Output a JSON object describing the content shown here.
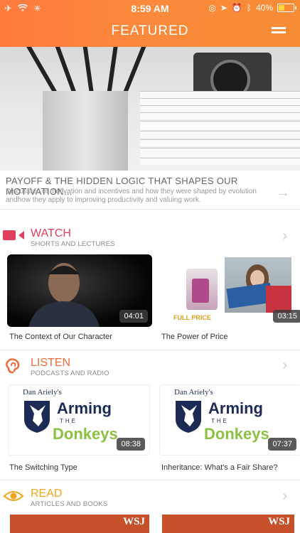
{
  "status_bar": {
    "time": "8:59 AM",
    "battery": "40%",
    "battery_level": 0.4
  },
  "header": {
    "title": "FEATURED"
  },
  "featured": {
    "title": "PAYOFF & THE HIDDEN LOGIC THAT SHAPES OUR MOTIVATION...",
    "description": "Discussion of motivation and incentives and how they were shaped by evolution andhow they apply to improving productivity and valuing work."
  },
  "watch": {
    "title": "WATCH",
    "subtitle": "SHORTS AND LECTURES",
    "color": "#e0405f",
    "items": [
      {
        "caption": "The Context of Our Character",
        "duration": "04:01"
      },
      {
        "caption": "The Power of Price",
        "duration": "03:15",
        "badge": "FULL PRICE"
      }
    ]
  },
  "listen": {
    "title": "LISTEN",
    "subtitle": "PODCASTS AND RADIO",
    "color": "#ef6a3a",
    "items": [
      {
        "caption": "The Switching Type",
        "duration": "08:38"
      },
      {
        "caption": "Inheritance: What's a Fair Share?",
        "duration": "07:37"
      }
    ],
    "artwork": {
      "author": "Dan Ariely's",
      "line1": "Arming",
      "line2": "THE",
      "line3": "Donkeys"
    }
  },
  "read": {
    "title": "READ",
    "subtitle": "ARTICLES AND BOOKS",
    "color": "#f2a51b",
    "items": [
      {
        "logo": "WSJ"
      },
      {
        "logo": "WSJ"
      }
    ]
  },
  "icons": {
    "airplane": "airplane-icon",
    "wifi": "wifi-icon",
    "menu": "hamburger-menu-icon",
    "watch": "video-camera-icon",
    "listen": "ear-icon",
    "read": "eye-icon"
  }
}
